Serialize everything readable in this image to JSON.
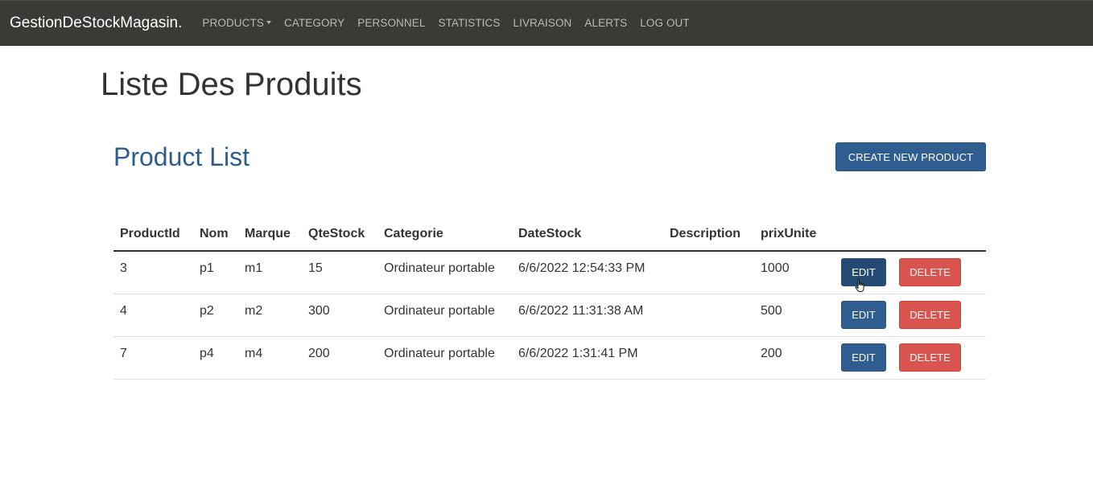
{
  "navbar": {
    "brand": "GestionDeStockMagasin.",
    "items": [
      {
        "label": "PRODUCTS",
        "dropdown": true
      },
      {
        "label": "CATEGORY"
      },
      {
        "label": "PERSONNEL"
      },
      {
        "label": "STATISTICS"
      },
      {
        "label": "LIVRAISON"
      },
      {
        "label": "ALERTS"
      },
      {
        "label": "LOG OUT"
      }
    ]
  },
  "page": {
    "title": "Liste Des Produits",
    "section_title": "Product List",
    "create_button": "CREATE NEW PRODUCT"
  },
  "table": {
    "headers": [
      "ProductId",
      "Nom",
      "Marque",
      "QteStock",
      "Categorie",
      "DateStock",
      "Description",
      "prixUnite"
    ],
    "rows": [
      {
        "id": "3",
        "nom": "p1",
        "marque": "m1",
        "qte": "15",
        "categorie": "Ordinateur portable",
        "date": "6/6/2022 12:54:33 PM",
        "description": "",
        "prix": "1000"
      },
      {
        "id": "4",
        "nom": "p2",
        "marque": "m2",
        "qte": "300",
        "categorie": "Ordinateur portable",
        "date": "6/6/2022 11:31:38 AM",
        "description": "",
        "prix": "500"
      },
      {
        "id": "7",
        "nom": "p4",
        "marque": "m4",
        "qte": "200",
        "categorie": "Ordinateur portable",
        "date": "6/6/2022 1:31:41 PM",
        "description": "",
        "prix": "200"
      }
    ],
    "edit_label": "EDIT",
    "delete_label": "DELETE"
  },
  "colors": {
    "navbar_bg": "#3a3a36",
    "primary": "#2f5d8f",
    "danger": "#d9534f",
    "heading_blue": "#2f5d89"
  }
}
